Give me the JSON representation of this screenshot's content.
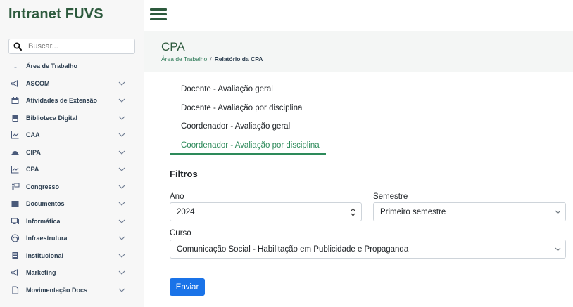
{
  "app": {
    "brand": "Intranet FUVS"
  },
  "search": {
    "placeholder": "Buscar..."
  },
  "sidebar": {
    "items": [
      {
        "label": "Área de Trabalho",
        "icon": "desktop-icon",
        "chevron": false
      },
      {
        "label": "ASCOM",
        "icon": "megaphone-icon",
        "chevron": true
      },
      {
        "label": "Atividades de Extensão",
        "icon": "calendar-icon",
        "chevron": true
      },
      {
        "label": "Biblioteca Digital",
        "icon": "book-icon",
        "chevron": true
      },
      {
        "label": "CAA",
        "icon": "line-chart-icon",
        "chevron": true
      },
      {
        "label": "CIPA",
        "icon": "hard-hat-icon",
        "chevron": true
      },
      {
        "label": "CPA",
        "icon": "line-chart-icon",
        "chevron": true
      },
      {
        "label": "Congresso",
        "icon": "presenter-icon",
        "chevron": true
      },
      {
        "label": "Documentos",
        "icon": "folders-icon",
        "chevron": true
      },
      {
        "label": "Informática",
        "icon": "computer-icon",
        "chevron": true
      },
      {
        "label": "Infraestrutura",
        "icon": "building-icon",
        "chevron": true
      },
      {
        "label": "Institucional",
        "icon": "institution-icon",
        "chevron": true
      },
      {
        "label": "Marketing",
        "icon": "megaphone-icon",
        "chevron": true
      },
      {
        "label": "Movimentação Docs",
        "icon": "document-icon",
        "chevron": true
      }
    ]
  },
  "header": {
    "title": "CPA",
    "breadcrumb": {
      "parent": "Área de Trabalho",
      "separator": "/",
      "current": "Relatório da CPA"
    }
  },
  "tabs": [
    {
      "label": "Docente - Avaliação geral",
      "active": false
    },
    {
      "label": "Docente - Avaliação por disciplina",
      "active": false
    },
    {
      "label": "Coordenador - Avaliação geral",
      "active": false
    },
    {
      "label": "Coordenador - Avaliação por disciplina",
      "active": true
    }
  ],
  "filters": {
    "heading": "Filtros",
    "ano": {
      "label": "Ano",
      "value": "2024"
    },
    "semestre": {
      "label": "Semestre",
      "value": "Primeiro semestre"
    },
    "curso": {
      "label": "Curso",
      "value": "Comunicação Social - Habilitação em Publicidade e Propaganda"
    },
    "submit_label": "Enviar"
  },
  "colors": {
    "brand": "#2d5a3d",
    "accent": "#2d8a5a",
    "button": "#1a73e8"
  }
}
